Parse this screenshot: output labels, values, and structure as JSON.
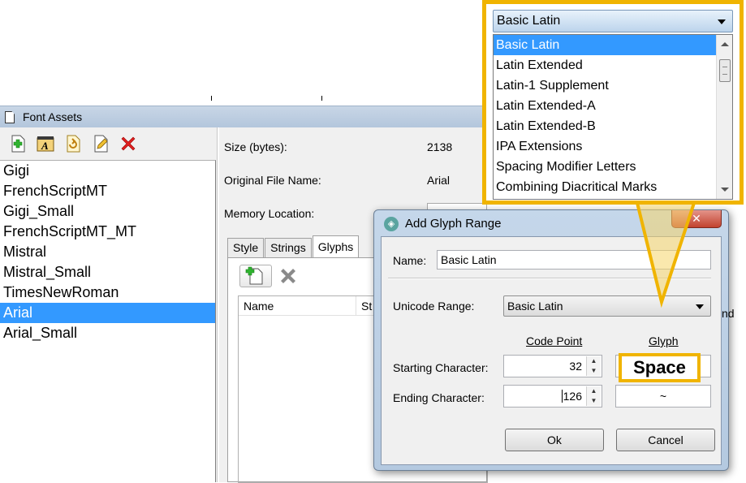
{
  "font_assets": {
    "title": "Font Assets",
    "fonts": [
      "Gigi",
      "FrenchScriptMT",
      "Gigi_Small",
      "FrenchScriptMT_MT",
      "Mistral",
      "Mistral_Small",
      "TimesNewRoman",
      "Arial",
      "Arial_Small"
    ],
    "selected_font": "Arial",
    "properties": {
      "size_label": "Size (bytes):",
      "size_value": "2138",
      "file_label": "Original File Name:",
      "file_value": "Arial",
      "memory_label": "Memory Location:"
    },
    "tabs": [
      "Style",
      "Strings",
      "Glyphs"
    ],
    "active_tab": "Glyphs",
    "table_columns": [
      "Name",
      "St"
    ],
    "partial_column_right": "nd"
  },
  "dialog": {
    "title": "Add Glyph Range",
    "close_symbol": "✕",
    "name_label": "Name:",
    "name_value": "Basic Latin",
    "unicode_label": "Unicode Range:",
    "unicode_value": "Basic Latin",
    "code_point_header": "Code Point",
    "glyph_header": "Glyph",
    "start_label": "Starting Character:",
    "start_value": "32",
    "start_glyph": "Space",
    "end_label": "Ending Character:",
    "end_value": "126",
    "end_glyph": "~",
    "ok_label": "Ok",
    "cancel_label": "Cancel"
  },
  "zoom": {
    "selected": "Basic Latin",
    "options": [
      "Basic Latin",
      "Latin Extended",
      "Latin-1 Supplement",
      "Latin Extended-A",
      "Latin Extended-B",
      "IPA Extensions",
      "Spacing Modifier Letters",
      "Combining Diacritical Marks"
    ]
  },
  "colors": {
    "highlight": "#f0b400",
    "selection": "#3399ff"
  }
}
